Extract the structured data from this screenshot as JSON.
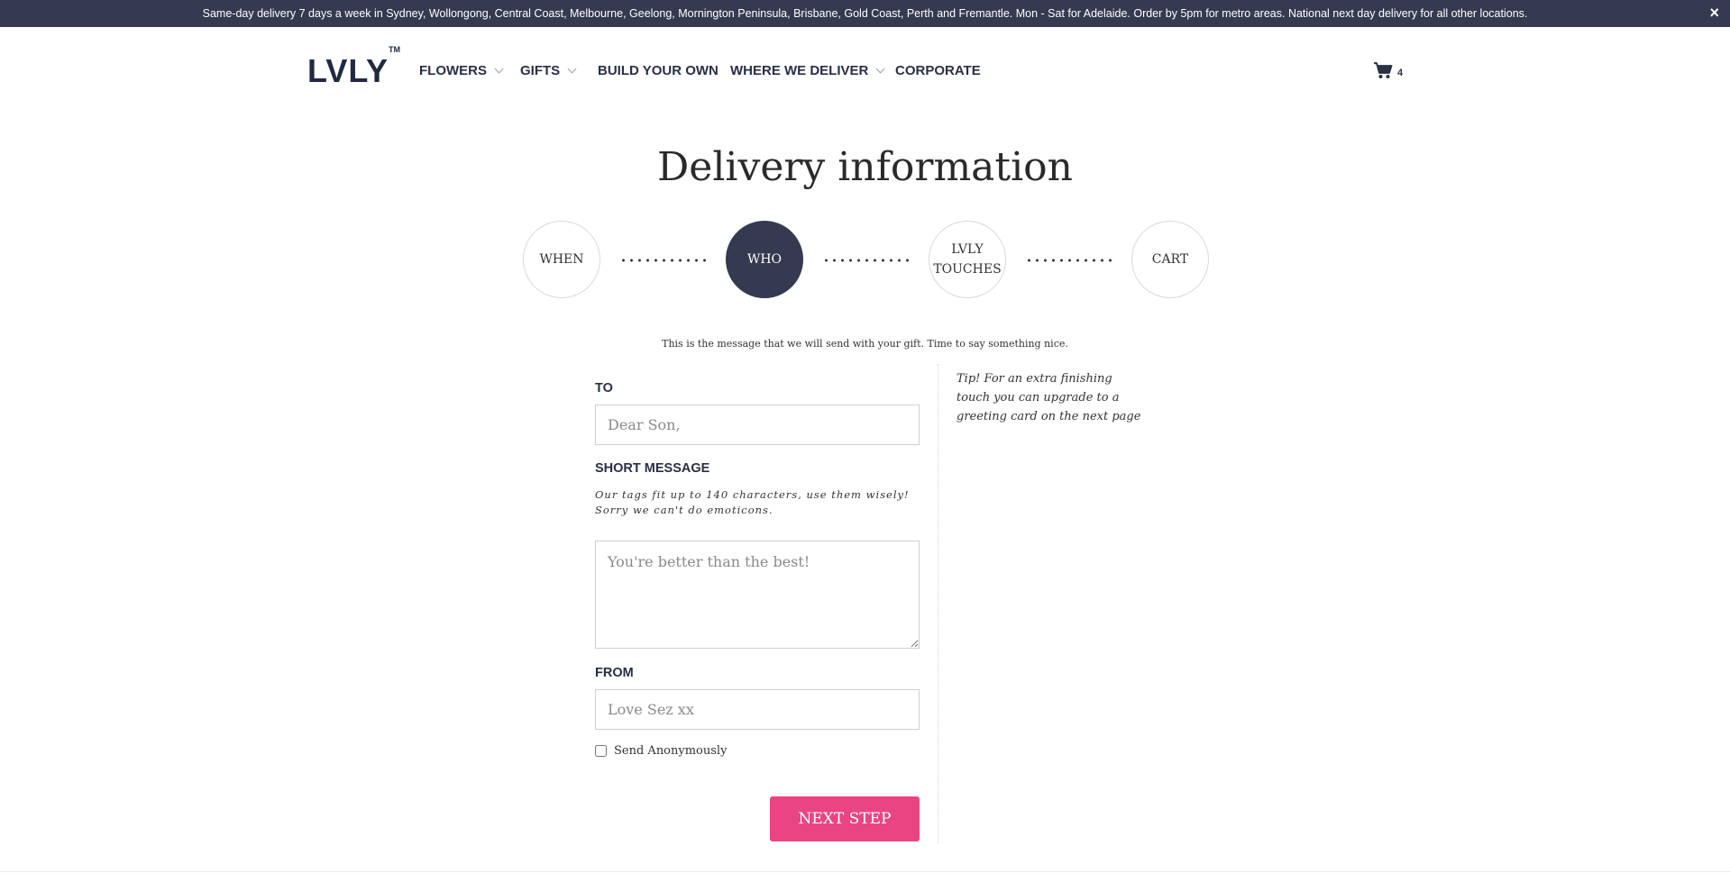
{
  "announcement": {
    "text": "Same-day delivery 7 days a week in Sydney, Wollongong, Central Coast, Melbourne, Geelong, Mornington Peninsula, Brisbane, Gold Coast, Perth and Fremantle. Mon - Sat for Adelaide. Order by 5pm for metro areas. National next day delivery for all other locations.",
    "close_icon": "×"
  },
  "brand": {
    "name": "LVLY",
    "trademark": "TM"
  },
  "nav": {
    "flowers": "FLOWERS",
    "gifts": "GIFTS",
    "build": "BUILD YOUR OWN",
    "deliver": "WHERE WE DELIVER",
    "corporate": "CORPORATE"
  },
  "cart": {
    "icon": "shopping-cart-icon",
    "count": "4"
  },
  "page": {
    "title": "Delivery information"
  },
  "steps": {
    "when": "WHEN",
    "who": "WHO",
    "touches_line1": "LVLY",
    "touches_line2": "TOUCHES",
    "cart": "CART",
    "active": "WHO"
  },
  "intro": "This is the message that we will send with your gift. Time to say something nice.",
  "form": {
    "to_label": "TO",
    "to_placeholder": "Dear Son,",
    "message_label": "SHORT MESSAGE",
    "message_hint_line1": "Our tags fit up to 140 characters, use them wisely!",
    "message_hint_line2": "Sorry we can't do emoticons.",
    "message_placeholder": "You're better than the best!",
    "from_label": "FROM",
    "from_placeholder": "Love Sez xx",
    "anonymous_label": "Send Anonymously",
    "next_button": "NEXT STEP"
  },
  "tip": "Tip! For an extra finishing touch you can upgrade to a greeting card on the next page",
  "colors": {
    "dark": "#353a50",
    "accent": "#ea4583"
  }
}
